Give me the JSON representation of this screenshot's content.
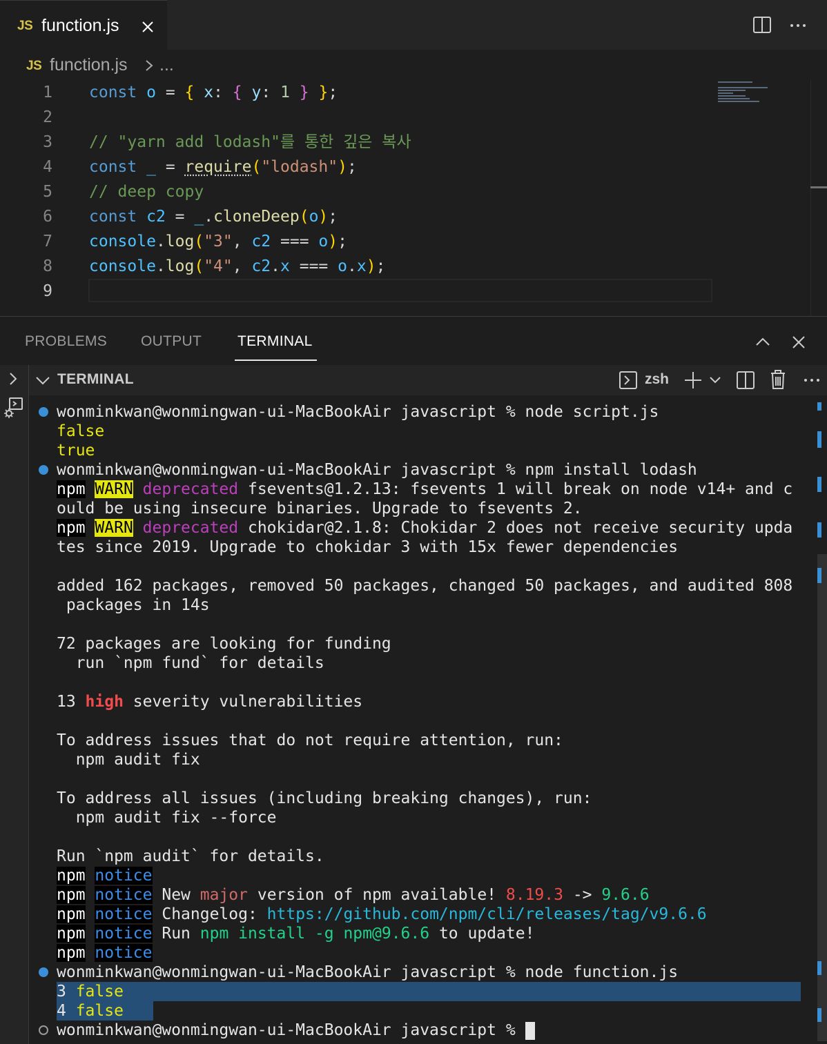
{
  "tab": {
    "badge": "JS",
    "title": "function.js"
  },
  "breadcrumb": {
    "badge": "JS",
    "file": "function.js",
    "ellipsis": "..."
  },
  "editor": {
    "line_numbers": [
      "1",
      "2",
      "3",
      "4",
      "5",
      "6",
      "7",
      "8",
      "9"
    ],
    "active_line": 9,
    "lines": [
      "const o = { x: { y: 1 } };",
      "",
      "// \"yarn add lodash\"를 통한 깊은 복사",
      "const _ = require(\"lodash\");",
      "// deep copy",
      "const c2 = _.cloneDeep(o);",
      "console.log(\"3\", c2 === o);",
      "console.log(\"4\", c2.x === o.x);",
      ""
    ]
  },
  "panel": {
    "tabs": [
      "PROBLEMS",
      "OUTPUT",
      "TERMINAL"
    ],
    "active_tab": "TERMINAL",
    "section_title": "TERMINAL",
    "shell": "zsh"
  },
  "terminal": {
    "prompt": "wonminkwan@wonmingwan-ui-MacBookAir javascript % ",
    "cmd1": "node script.js",
    "out_false": "false",
    "out_true": "true",
    "cmd2": "npm install lodash",
    "npm": "npm",
    "warn": "WARN",
    "deprecated": "deprecated",
    "warn1_a": " fsevents@1.2.13: fsevents 1 will break on node v14+ and c",
    "warn1_b": "ould be using insecure binaries. Upgrade to fsevents 2.",
    "warn2_a": " chokidar@2.1.8: Chokidar 2 does not receive security upda",
    "warn2_b": "tes since 2019. Upgrade to chokidar 3 with 15x fewer dependencies",
    "added_a": "added 162 packages, removed 50 packages, changed 50 packages, and audited 808",
    "added_b": " packages in 14s",
    "funding_a": "72 packages are looking for funding",
    "funding_b": "  run `npm fund` for details",
    "vuln_count": "13 ",
    "vuln_high": "high",
    "vuln_rest": " severity vulnerabilities",
    "fix1_a": "To address issues that do not require attention, run:",
    "fix1_b": "  npm audit fix",
    "fix2_a": "To address all issues (including breaking changes), run:",
    "fix2_b": "  npm audit fix --force",
    "audit": "Run `npm audit` for details.",
    "notice": "notice",
    "n2_a": " New ",
    "n2_major": "major",
    "n2_b": " version of npm available! ",
    "n2_old": "8.19.3",
    "n2_arrow": " -> ",
    "n2_new": "9.6.6",
    "n3_a": " Changelog: ",
    "n3_link": "https://github.com/npm/cli/releases/tag/v9.6.6",
    "n4_a": " Run ",
    "n4_cmd": "npm install -g npm@9.6.6",
    "n4_b": " to update!",
    "cmd3": "node function.js",
    "r3_num": "3 ",
    "r3_val": "false",
    "r4_num": "4 ",
    "r4_val": "false"
  },
  "colors": {
    "accent": "#3a8fd6",
    "selection": "#264f78",
    "warn_bg": "#e5e510",
    "error": "#f14c4c"
  }
}
